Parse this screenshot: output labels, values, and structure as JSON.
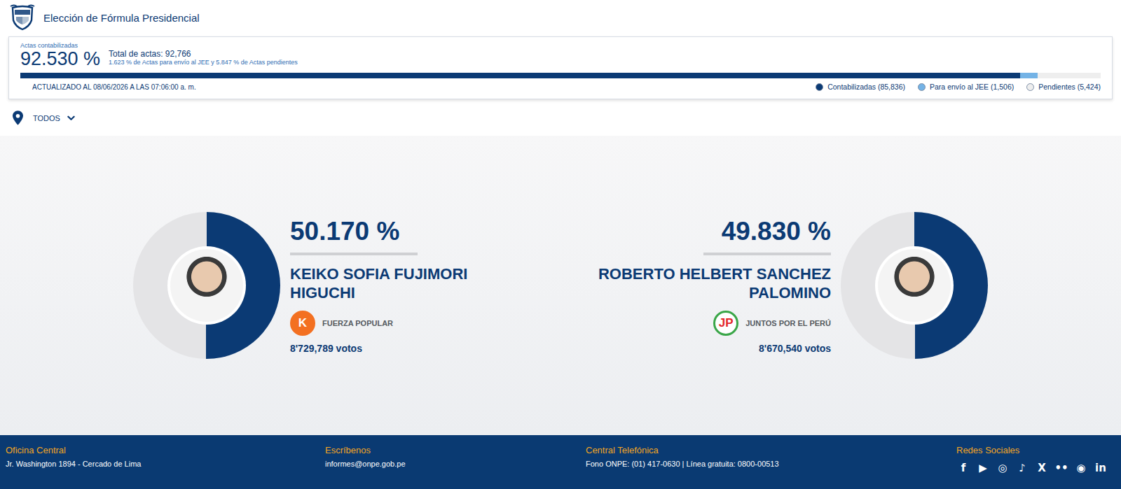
{
  "header": {
    "title": "Elección de Fórmula Presidencial"
  },
  "progress": {
    "label": "Actas contabilizadas",
    "percent": "92.530 %",
    "total": "Total de actas: 92,766",
    "detail": "1.623 % de Actas para envío al JEE y 5.847 % de Actas pendientes",
    "updated": "ACTUALIZADO AL 08/06/2026 A LAS 07:06:00 a. m.",
    "segments": [
      {
        "label": "Contabilizadas (85,836)",
        "level": 0.9253,
        "color": "#0b3a74"
      },
      {
        "label": "Para envío al JEE (1,506)",
        "level": 0.01623,
        "color": "#74b3e6"
      },
      {
        "label": "Pendientes (5,424)",
        "level": 0.05847,
        "color": "#eeeeee"
      }
    ]
  },
  "filter": {
    "label": "TODOS"
  },
  "candidates": [
    {
      "percent": "50.170 %",
      "level": 0.5017,
      "name": "KEIKO SOFIA FUJIMORI HIGUCHI",
      "party": "FUERZA POPULAR",
      "logo": {
        "text": "K",
        "kind": "filled",
        "color": "#f37021"
      },
      "votes": "8'729,789 votos"
    },
    {
      "percent": "49.830 %",
      "level": 0.4983,
      "name": "ROBERTO HELBERT SANCHEZ PALOMINO",
      "party": "JUNTOS POR EL PERÚ",
      "logo": {
        "text": "JP",
        "kind": "ring",
        "color": "#3aa648"
      },
      "votes": "8'670,540 votos"
    }
  ],
  "footer": {
    "columns": [
      {
        "title": "Oficina Central",
        "text": "Jr. Washington 1894 - Cercado de Lima"
      },
      {
        "title": "Escríbenos",
        "text": "informes@onpe.gob.pe"
      },
      {
        "title": "Central Telefónica",
        "text": "Fono ONPE: (01) 417-0630 | Línea gratuita: 0800-00513"
      }
    ],
    "social": {
      "title": "Redes Sociales",
      "icons": [
        "f",
        "▶",
        "◎",
        "♪",
        "X",
        "••",
        "◉",
        "in"
      ]
    }
  }
}
